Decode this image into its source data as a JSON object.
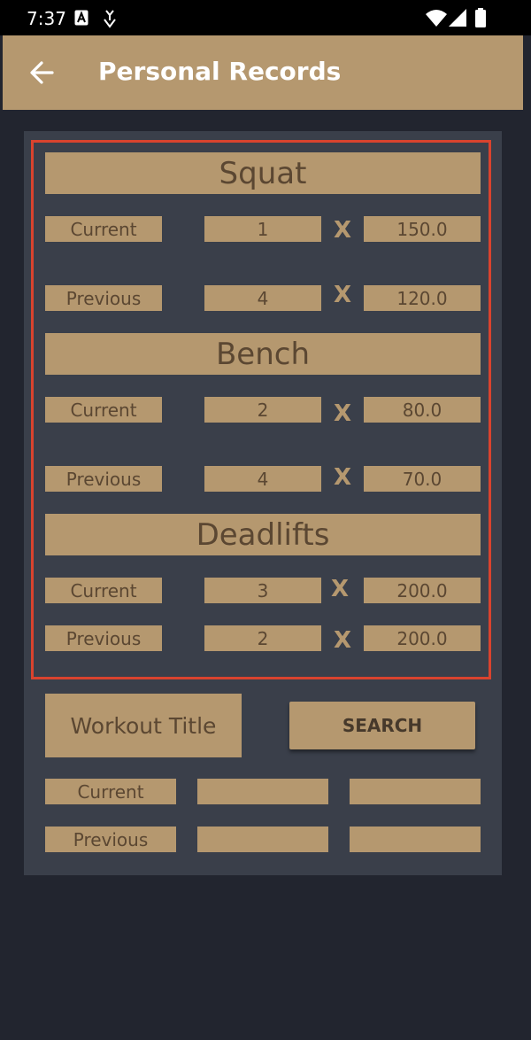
{
  "status_bar": {
    "time": "7:37"
  },
  "app_bar": {
    "title": "Personal Records"
  },
  "sections": [
    {
      "header": "Squat",
      "current": {
        "label": "Current",
        "reps": "1",
        "sep": "X",
        "weight": "150.0"
      },
      "previous": {
        "label": "Previous",
        "reps": "4",
        "sep": "X",
        "weight": "120.0"
      }
    },
    {
      "header": "Bench",
      "current": {
        "label": "Current",
        "reps": "2",
        "sep": "X",
        "weight": "80.0"
      },
      "previous": {
        "label": "Previous",
        "reps": "4",
        "sep": "X",
        "weight": "70.0"
      }
    },
    {
      "header": "Deadlifts",
      "current": {
        "label": "Current",
        "reps": "3",
        "sep": "X",
        "weight": "200.0"
      },
      "previous": {
        "label": "Previous",
        "reps": "2",
        "sep": "X",
        "weight": "200.0"
      }
    }
  ],
  "search": {
    "workout_title": "Workout Title",
    "button_label": "SEARCH",
    "current_label": "Current",
    "previous_label": "Previous",
    "current_reps": "",
    "current_weight": "",
    "previous_reps": "",
    "previous_weight": ""
  }
}
